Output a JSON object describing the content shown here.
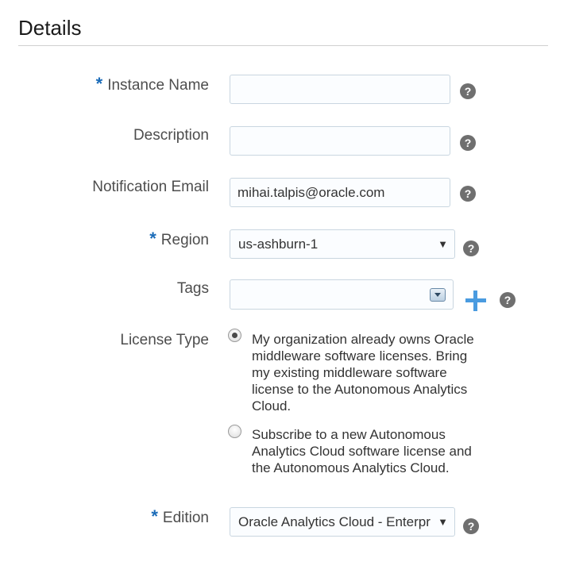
{
  "section": {
    "title": "Details"
  },
  "form": {
    "required_marker": "*",
    "instance_name": {
      "label": "Instance Name",
      "value": ""
    },
    "description": {
      "label": "Description",
      "value": ""
    },
    "notification_email": {
      "label": "Notification Email",
      "value": "mihai.talpis@oracle.com"
    },
    "region": {
      "label": "Region",
      "value": "us-ashburn-1",
      "caret": "▼"
    },
    "tags": {
      "label": "Tags",
      "value": ""
    },
    "license_type": {
      "label": "License Type",
      "options": [
        {
          "text": "My organization already owns Oracle middleware software licenses. Bring my existing middleware software license to the Autonomous Analytics Cloud.",
          "selected": true
        },
        {
          "text": "Subscribe to a new Autonomous Analytics Cloud software license and the Autonomous Analytics Cloud.",
          "selected": false
        }
      ]
    },
    "edition": {
      "label": "Edition",
      "value": "Oracle Analytics Cloud - Enterprise Edition",
      "caret": "▼"
    },
    "help_glyph": "?"
  },
  "colors": {
    "required": "#1a6bb8",
    "add_icon": "#4a9be0",
    "help_icon": "#6f6f6f"
  }
}
